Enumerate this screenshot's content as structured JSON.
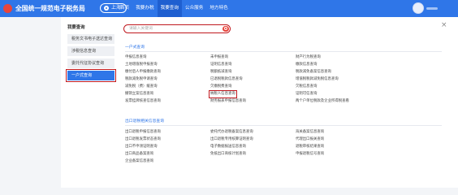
{
  "header": {
    "site_title": "全国统一规范电子税务局",
    "region": "上海",
    "nav": [
      {
        "label": "首页",
        "active": false
      },
      {
        "label": "我要办税",
        "active": false
      },
      {
        "label": "我要查询",
        "active": true
      },
      {
        "label": "公众服务",
        "active": false
      },
      {
        "label": "地方特色",
        "active": false
      }
    ]
  },
  "sidebar": {
    "title": "我要查询",
    "items": [
      {
        "label": "税务文书电子送达查询",
        "active": false
      },
      {
        "label": "涉税信息查询",
        "active": false
      },
      {
        "label": "委托代征协议查询",
        "active": false
      },
      {
        "label": "一户式查询",
        "active": true
      }
    ]
  },
  "search": {
    "placeholder": "请输入关键词"
  },
  "sections": [
    {
      "title": "一户式查询",
      "columns": [
        [
          "申报信息查询",
          "土地增值税申报查询",
          "缴付后人申报缴款查询",
          "税款减免税申请查询",
          "减免税（费）缓查询",
          "撤销立案信息查询",
          "发票挂牌核查信息查询"
        ],
        [
          "未申报查询",
          "证明信息查询",
          "税额抵减查询",
          "已退税税款信息查询",
          "欠缴税费查询",
          "纳税人信息查询",
          "财务报表申报信息查询"
        ],
        [
          "财产行为税查询",
          "缴款信息查询",
          "税款减免备案信息查询",
          "增值税税款减免税信息查询",
          "欠税信息查询",
          "证明可信查询",
          "两个户单位税款及企业所得税查看"
        ]
      ],
      "highlighted": "纳税人信息查询"
    },
    {
      "title": "出口退税相关信息查询",
      "columns": [
        [
          "出口退税申报信息查询",
          "出口退税发票状态查询",
          "出口不申领证明查询",
          "出口商品备案查询",
          "企业备案信息查询"
        ],
        [
          "委托代办退税备案信息查询",
          "出口退税专用核算证明查询",
          "电子数据报送信息查询",
          "免抵出口商核计划查询"
        ],
        [
          "海关备案信息查询",
          "代理出口报关查询",
          "退税审核结果查询",
          "申报退税信号查询"
        ]
      ]
    }
  ]
}
